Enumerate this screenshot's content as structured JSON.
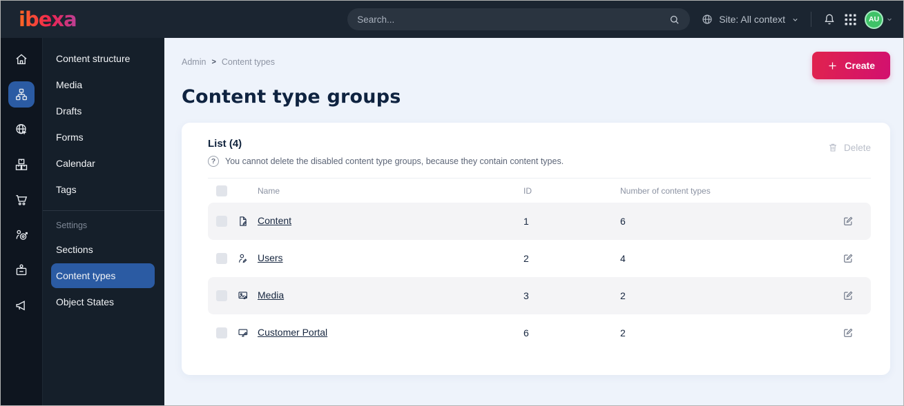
{
  "brand": {
    "logo": "ibexa"
  },
  "topbar": {
    "search_placeholder": "Search...",
    "site_label": "Site: All context",
    "avatar": "AU",
    "icons": [
      "globe-icon",
      "chevron-down-icon",
      "bell-icon",
      "app-grid-icon",
      "avatar-chevron-icon",
      "search-icon"
    ]
  },
  "sidebar": {
    "rail_icons": [
      "home-icon",
      "content-tree-icon",
      "site-globe-icon",
      "products-boxes-icon",
      "cart-icon",
      "personalization-target-icon",
      "badge-icon",
      "megaphone-icon"
    ],
    "items": [
      {
        "label": "Content structure"
      },
      {
        "label": "Media"
      },
      {
        "label": "Drafts"
      },
      {
        "label": "Forms"
      },
      {
        "label": "Calendar"
      },
      {
        "label": "Tags"
      }
    ],
    "section_label": "Settings",
    "settings_items": [
      {
        "label": "Sections",
        "active": false
      },
      {
        "label": "Content types",
        "active": true
      },
      {
        "label": "Object States",
        "active": false
      }
    ]
  },
  "main": {
    "breadcrumb": {
      "root": "Admin",
      "separator": ">",
      "current": "Content types"
    },
    "create_button": "Create",
    "title": "Content type groups",
    "panel": {
      "list_title": "List (4)",
      "help_icon": "?",
      "help_text": "You cannot delete the disabled content type groups, because they contain content types.",
      "delete_button": "Delete",
      "table": {
        "columns": {
          "name": "Name",
          "id": "ID",
          "count": "Number of content types"
        },
        "rows": [
          {
            "icon": "content-file-icon",
            "name": "Content",
            "id": "1",
            "count": "6"
          },
          {
            "icon": "users-person-icon",
            "name": "Users",
            "id": "2",
            "count": "4"
          },
          {
            "icon": "media-image-icon",
            "name": "Media",
            "id": "3",
            "count": "2"
          },
          {
            "icon": "portal-screen-icon",
            "name": "Customer Portal",
            "id": "6",
            "count": "2"
          }
        ]
      }
    }
  },
  "colors": {
    "topbar_bg": "#1b2531",
    "rail_bg": "#0e151f",
    "menu_bg": "#151f2a",
    "main_bg": "#eef3fb",
    "accent_blue": "#2b5ba3",
    "brand_gradient": [
      "#ff6326",
      "#ee2450",
      "#bf3d8f"
    ],
    "button_gradient": [
      "#e0234e",
      "#d2106f"
    ],
    "avatar_green": "#3fc268",
    "avatar_ring": "#a9ecc4",
    "stripe_gray": "#f4f4f6",
    "text_dark": "#16263f"
  }
}
